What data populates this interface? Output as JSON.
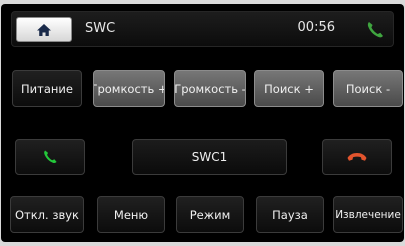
{
  "header": {
    "title": "SWC",
    "time": "00:56",
    "home_icon": "home-icon",
    "phone_icon": "phone-icon"
  },
  "row1": [
    "Питание",
    "Громкость +",
    "Громкость -",
    "Поиск +",
    "Поиск -"
  ],
  "row2": {
    "answer_icon": "phone-answer-icon",
    "display_value": "SWC1",
    "hangup_icon": "phone-hangup-icon"
  },
  "row3": [
    "Откл. звук",
    "Меню",
    "Режим",
    "Пауза",
    "Извлечение"
  ],
  "colors": {
    "background": "#000000",
    "answer_green": "#23c73a",
    "hangup_red": "#e2542d",
    "header_icon_green": "#3fa53f"
  }
}
